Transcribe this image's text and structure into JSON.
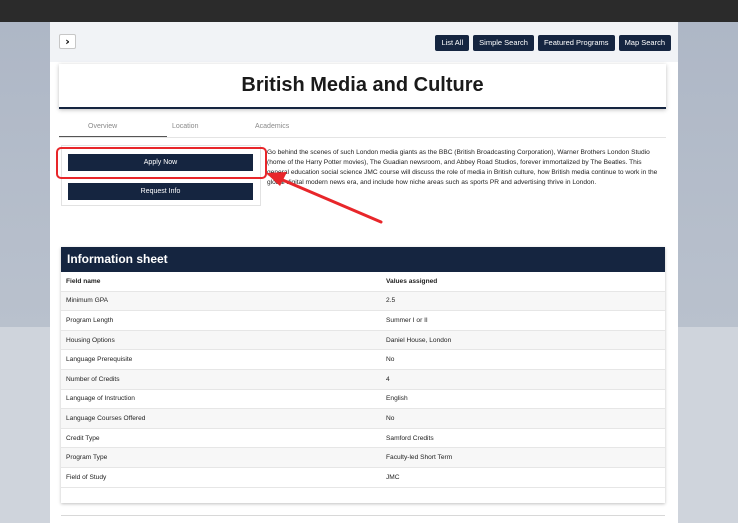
{
  "topnav": {
    "toggle_label": "›",
    "buttons": [
      "List All",
      "Simple Search",
      "Featured Programs",
      "Map Search"
    ]
  },
  "page": {
    "title": "British Media and Culture"
  },
  "tabs": [
    "Overview",
    "Location",
    "Academics"
  ],
  "actions": {
    "apply_label": "Apply Now",
    "request_label": "Request Info"
  },
  "description": "Go behind the scenes of such London media giants as the BBC (British Broadcasting Corporation), Warner Brothers London Studio (home of the Harry Potter movies), The Guadian newsroom, and Abbey Road Studios, forever immortalized by The Beatles. This general education social science JMC course will discuss the role of media in British culture, how British media continue to work in the global digital modern news era, and include how niche areas such as sports PR and advertising thrive in London.",
  "info_sheet": {
    "title": "Information sheet",
    "columns": [
      "Field name",
      "Values assigned"
    ],
    "rows": [
      [
        "Minimum GPA",
        "2.5"
      ],
      [
        "Program Length",
        "Summer I or II"
      ],
      [
        "Housing Options",
        "Daniel House, London"
      ],
      [
        "Language Prerequisite",
        "No"
      ],
      [
        "Number of Credits",
        "4"
      ],
      [
        "Language of Instruction",
        "English"
      ],
      [
        "Language Courses Offered",
        "No"
      ],
      [
        "Credit Type",
        "Samford Credits"
      ],
      [
        "Program Type",
        "Faculty-led Short Term"
      ],
      [
        "Field of Study",
        "JMC"
      ]
    ]
  },
  "colors": {
    "navy": "#152540",
    "annotation_red": "#e8262a"
  },
  "icons": {
    "arrow": "red-arrow-annotation"
  }
}
